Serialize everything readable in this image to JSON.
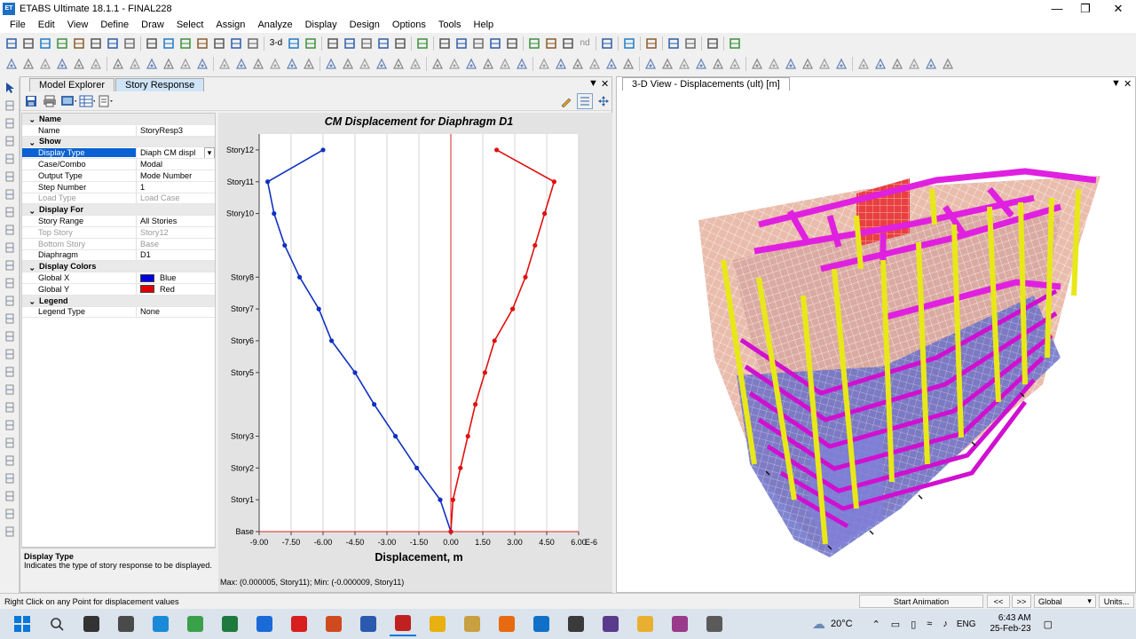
{
  "window": {
    "title": "ETABS Ultimate 18.1.1 - FINAL228",
    "app_badge": "ET"
  },
  "menu": [
    "File",
    "Edit",
    "View",
    "Define",
    "Draw",
    "Select",
    "Assign",
    "Analyze",
    "Display",
    "Design",
    "Options",
    "Tools",
    "Help"
  ],
  "toolbar_text": {
    "view3d": "3-d",
    "nd": "nd"
  },
  "left_panel": {
    "tabs": [
      {
        "label": "Model Explorer",
        "active": false
      },
      {
        "label": "Story Response",
        "active": true
      }
    ],
    "properties": [
      {
        "type": "group",
        "label": "Name"
      },
      {
        "type": "row",
        "key": "Name",
        "value": "StoryResp3"
      },
      {
        "type": "group",
        "label": "Show"
      },
      {
        "type": "row",
        "key": "Display Type",
        "value": "Diaph CM displ",
        "selected": true,
        "dropdown": true
      },
      {
        "type": "row",
        "key": "Case/Combo",
        "value": "Modal"
      },
      {
        "type": "row",
        "key": "Output Type",
        "value": "Mode Number"
      },
      {
        "type": "row",
        "key": "Step Number",
        "value": "1"
      },
      {
        "type": "row",
        "key": "Load Type",
        "value": "Load Case",
        "dim": true
      },
      {
        "type": "group",
        "label": "Display For"
      },
      {
        "type": "row",
        "key": "Story Range",
        "value": "All Stories"
      },
      {
        "type": "row",
        "key": "Top Story",
        "value": "Story12",
        "dim": true
      },
      {
        "type": "row",
        "key": "Bottom Story",
        "value": "Base",
        "dim": true
      },
      {
        "type": "row",
        "key": "Diaphragm",
        "value": "D1"
      },
      {
        "type": "group",
        "label": "Display Colors"
      },
      {
        "type": "row",
        "key": "Global X",
        "value": "Blue",
        "swatch": "#0000e0"
      },
      {
        "type": "row",
        "key": "Global Y",
        "value": "Red",
        "swatch": "#e00000"
      },
      {
        "type": "group",
        "label": "Legend"
      },
      {
        "type": "row",
        "key": "Legend Type",
        "value": "None"
      }
    ],
    "help": {
      "title": "Display Type",
      "text": "Indicates the type of story response to be displayed."
    }
  },
  "chart_data": {
    "type": "line",
    "title": "CM Displacement for Diaphragm D1",
    "xlabel": "Displacement, m",
    "x_unit_label": "E-6",
    "xlim": [
      -9,
      6
    ],
    "x_ticks": [
      "-9.00",
      "-7.50",
      "-6.00",
      "-4.50",
      "-3.00",
      "-1.50",
      "0.00",
      "1.50",
      "3.00",
      "4.50",
      "6.00"
    ],
    "x_tick_values": [
      -9,
      -7.5,
      -6,
      -4.5,
      -3,
      -1.5,
      0,
      1.5,
      3,
      4.5,
      6
    ],
    "story_labels": [
      {
        "label": "Story12",
        "elev": 12
      },
      {
        "label": "Story11",
        "elev": 11
      },
      {
        "label": "Story10",
        "elev": 10
      },
      {
        "label": "Story8",
        "elev": 8
      },
      {
        "label": "Story7",
        "elev": 7
      },
      {
        "label": "Story6",
        "elev": 6
      },
      {
        "label": "Story5",
        "elev": 5
      },
      {
        "label": "Story3",
        "elev": 3
      },
      {
        "label": "Story2",
        "elev": 2
      },
      {
        "label": "Story1",
        "elev": 1
      },
      {
        "label": "Base",
        "elev": 0
      }
    ],
    "ylim": [
      0,
      12.5
    ],
    "series": [
      {
        "name": "Global X",
        "color": "#1030c0",
        "points": [
          [
            0,
            0
          ],
          [
            -0.5,
            1
          ],
          [
            -1.6,
            2
          ],
          [
            -2.6,
            3
          ],
          [
            -3.6,
            4
          ],
          [
            -4.5,
            5
          ],
          [
            -5.6,
            6
          ],
          [
            -6.2,
            7
          ],
          [
            -7.1,
            8
          ],
          [
            -7.8,
            9
          ],
          [
            -8.3,
            10
          ],
          [
            -8.6,
            11
          ],
          [
            -6.0,
            12
          ]
        ]
      },
      {
        "name": "Global Y",
        "color": "#e01010",
        "points": [
          [
            0,
            0
          ],
          [
            0.1,
            1
          ],
          [
            0.45,
            2
          ],
          [
            0.8,
            3
          ],
          [
            1.15,
            4
          ],
          [
            1.6,
            5
          ],
          [
            2.05,
            6
          ],
          [
            2.9,
            7
          ],
          [
            3.5,
            8
          ],
          [
            3.95,
            9
          ],
          [
            4.4,
            10
          ],
          [
            4.85,
            11
          ],
          [
            2.15,
            12
          ]
        ]
      }
    ],
    "summary": "Max: (0.000005, Story11);   Min: (-0.000009, Story11)"
  },
  "view3d": {
    "tab_label": "3-D View  - Displacements (ult)  [m]"
  },
  "status": {
    "hint": "Right Click on any Point for displacement values",
    "animation_button": "Start Animation",
    "prev": "<<",
    "next": ">>",
    "coord_system": "Global",
    "units_button": "Units..."
  },
  "taskbar": {
    "weather": "20°C",
    "lang": "ENG",
    "time": "6:43 AM",
    "date": "25-Feb-23",
    "apps": [
      "windows",
      "search",
      "taskview",
      "camera",
      "edge",
      "chrome",
      "excel",
      "store",
      "acrobat",
      "powerpoint",
      "word",
      "etabs",
      "yellow",
      "grid",
      "firefox",
      "outlook",
      "settings",
      "sap",
      "files",
      "winrar",
      "windowsapp"
    ]
  },
  "colors": {
    "accent": "#0a62d2",
    "tab_active": "#cfe4f7",
    "series_x": "#1030c0",
    "series_y": "#e01010"
  }
}
